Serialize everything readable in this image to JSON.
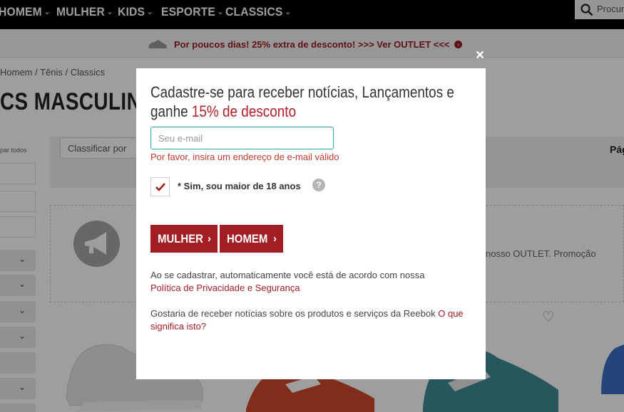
{
  "nav": {
    "items": [
      "HOMEM",
      "MULHER",
      "KIDS",
      "ESPORTE",
      "CLASSICS"
    ],
    "search_placeholder": "Procura"
  },
  "promo": {
    "text": "Por poucos dias! 25% extra de desconto! >>> Ver OUTLET <<<"
  },
  "page": {
    "breadcrumb": [
      "Homem",
      "Tênis",
      "Classics"
    ],
    "title_fragment": "CS MASCULINOS",
    "sidebar_clear": "par todos",
    "sort_label": "Classificar por",
    "page_label": "Pág",
    "outlet_fragment": "nosso OUTLET. Promoção"
  },
  "modal": {
    "title_part1": "Cadastre-se para receber notícias, Lançamentos e ganhe ",
    "title_accent": "15% de desconto",
    "email_placeholder": "Seu e-mail",
    "error": "Por favor, insira um endereço de e-mail válido",
    "age_label": "* Sim, sou maior de 18 anos",
    "age_checked": true,
    "help_symbol": "?",
    "close_symbol": "×",
    "buttons": {
      "women": "MULHER",
      "men": "HOMEM"
    },
    "agree_text": "Ao se cadastrar, automaticamente você está de acordo com nossa",
    "privacy_link": "Política de Privacidade e Segurança",
    "news_text": "Gostaria de receber notícias sobre os produtos e serviços da Reebok",
    "news_link": "O que significa isto?"
  },
  "colors": {
    "accent": "#a31d24",
    "nav_bg": "#000000",
    "input_focus": "#3a9fb4"
  }
}
